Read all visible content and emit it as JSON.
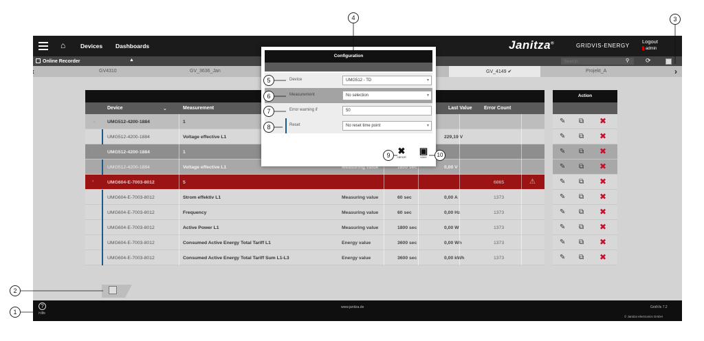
{
  "topbar": {
    "nav_devices": "Devices",
    "nav_dashboards": "Dashboards",
    "brand": "Janitza",
    "brand_reg": "®",
    "brand_sub": "GRIDVIS-ENERGY",
    "logout": "Logout",
    "user": "admin"
  },
  "secondbar": {
    "online_recorder": "Online Recorder",
    "search_placeholder": "Search"
  },
  "tabs": [
    "GV4310",
    "GV_3636_Jan",
    "GV_4149 ✔",
    "Projekt_A"
  ],
  "table": {
    "headers": {
      "device": "Device",
      "measurement": "Measurement",
      "last_value": "Last Value",
      "error_count": "Error Count"
    },
    "rows": [
      {
        "device": "UMG512-4200-1884",
        "measurement": "1",
        "type": "",
        "interval": "",
        "last": "",
        "errors": ""
      },
      {
        "device": "UMG512-4200-1884",
        "measurement": "Voltage effective L1",
        "type": "",
        "interval": "",
        "last": "229,19 V",
        "errors": ""
      },
      {
        "device": "UMG512-4200-1884",
        "measurement": "1",
        "type": "",
        "interval": "",
        "last": "",
        "errors": ""
      },
      {
        "device": "UMG512-4200-1884",
        "measurement": "Voltage effective L1",
        "type": "Measuring value",
        "interval": "1800 sec",
        "last": "0,00 V",
        "errors": ""
      },
      {
        "device": "UMG604-E-7003-8012",
        "measurement": "5",
        "type": "",
        "interval": "",
        "last": "",
        "errors": "6865"
      },
      {
        "device": "UMG604-E-7003-8012",
        "measurement": "Strom effektiv L1",
        "type": "Measuring value",
        "interval": "60 sec",
        "last": "0,00 A",
        "errors": "1373"
      },
      {
        "device": "UMG604-E-7003-8012",
        "measurement": "Frequency",
        "type": "Measuring value",
        "interval": "60 sec",
        "last": "0,00 Hz",
        "errors": "1373"
      },
      {
        "device": "UMG604-E-7003-8012",
        "measurement": "Active Power L1",
        "type": "Measuring value",
        "interval": "1800 sec",
        "last": "0,00 W",
        "errors": "1373"
      },
      {
        "device": "UMG604-E-7003-8012",
        "measurement": "Consumed Active Energy Total Tariff L1",
        "type": "Energy value",
        "interval": "3600 sec",
        "last": "0,00 Wh",
        "errors": "1373"
      },
      {
        "device": "UMG604-E-7003-8012",
        "measurement": "Consumed Active Energy Total Tariff Sum L1-L3",
        "type": "Energy value",
        "interval": "3600 sec",
        "last": "0,00 kWh",
        "errors": "1373"
      }
    ]
  },
  "actions": {
    "header": "Action"
  },
  "modal": {
    "title": "Configuration",
    "fields": {
      "device_label": "Device",
      "device_value": "UMG512 - TD",
      "measurement_label": "Measurement",
      "measurement_value": "No selection",
      "error_label": "Error warning if",
      "error_value": "50",
      "reset_label": "Reset",
      "reset_value": "No reset time point"
    },
    "cancel": "cancel",
    "save": "save"
  },
  "footer": {
    "help": "Hilfe",
    "url": "www.janitza.de",
    "version": "GridVis 7.2",
    "copyright": "© Janitza electronics GmbH"
  },
  "callouts": [
    "1",
    "2",
    "3",
    "4",
    "5",
    "6",
    "7",
    "8",
    "9",
    "10"
  ],
  "colors": {
    "error_row": "#9b1313",
    "accent_blue": "#1b5a8a",
    "delete_red": "#c8102e"
  }
}
